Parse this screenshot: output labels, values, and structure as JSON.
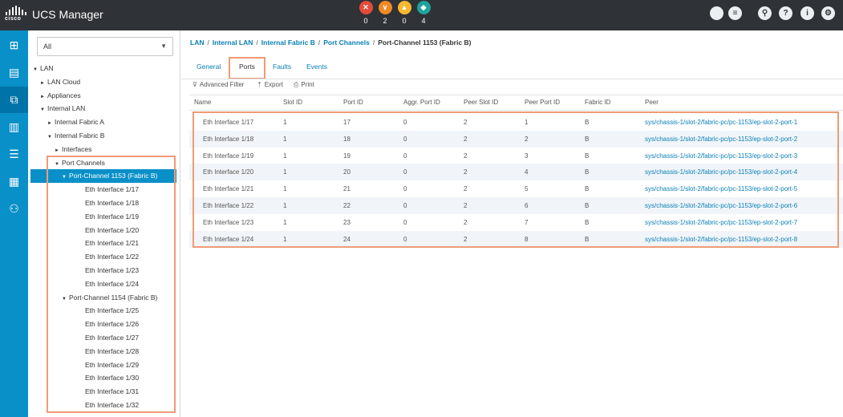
{
  "header": {
    "title": "UCS Manager",
    "logo_text": "cisco",
    "faults": [
      {
        "icon": "critical-x-icon",
        "count": "0",
        "color": "#e44c3a",
        "glyph": "✕"
      },
      {
        "icon": "major-chevron-icon",
        "count": "2",
        "color": "#f08a24",
        "glyph": "∨"
      },
      {
        "icon": "minor-triangle-icon",
        "count": "0",
        "color": "#f5b82e",
        "glyph": "▲"
      },
      {
        "icon": "warning-diamond-icon",
        "count": "4",
        "color": "#1fa39b",
        "glyph": "◆"
      }
    ],
    "right_icons": [
      "circle-icon",
      "menu-icon",
      "search-icon",
      "help-icon",
      "info-icon",
      "settings-icon"
    ]
  },
  "rail": {
    "items": [
      "equipment-icon",
      "servers-icon",
      "lan-icon",
      "san-icon",
      "storage-icon",
      "vm-icon",
      "admin-icon"
    ],
    "active_index": 2
  },
  "navigator": {
    "filter_value": "All",
    "tree": [
      {
        "label": "LAN",
        "level": 0,
        "arrow": "▼"
      },
      {
        "label": "LAN Cloud",
        "level": 1,
        "arrow": "►"
      },
      {
        "label": "Appliances",
        "level": 1,
        "arrow": "►"
      },
      {
        "label": "Internal LAN",
        "level": 1,
        "arrow": "▼"
      },
      {
        "label": "Internal Fabric A",
        "level": 2,
        "arrow": "►"
      },
      {
        "label": "Internal Fabric B",
        "level": 2,
        "arrow": "▼"
      },
      {
        "label": "Interfaces",
        "level": 3,
        "arrow": "►"
      },
      {
        "label": "Port Channels",
        "level": 3,
        "arrow": "▼"
      },
      {
        "label": "Port-Channel 1153 (Fabric B)",
        "level": 4,
        "arrow": "▼",
        "selected": true
      },
      {
        "label": "Eth Interface 1/17",
        "level": 5,
        "arrow": ""
      },
      {
        "label": "Eth Interface 1/18",
        "level": 5,
        "arrow": ""
      },
      {
        "label": "Eth Interface 1/19",
        "level": 5,
        "arrow": ""
      },
      {
        "label": "Eth Interface 1/20",
        "level": 5,
        "arrow": ""
      },
      {
        "label": "Eth Interface 1/21",
        "level": 5,
        "arrow": ""
      },
      {
        "label": "Eth Interface 1/22",
        "level": 5,
        "arrow": ""
      },
      {
        "label": "Eth Interface 1/23",
        "level": 5,
        "arrow": ""
      },
      {
        "label": "Eth Interface 1/24",
        "level": 5,
        "arrow": ""
      },
      {
        "label": "Port-Channel 1154 (Fabric B)",
        "level": 4,
        "arrow": "▼"
      },
      {
        "label": "Eth Interface 1/25",
        "level": 5,
        "arrow": ""
      },
      {
        "label": "Eth Interface 1/26",
        "level": 5,
        "arrow": ""
      },
      {
        "label": "Eth Interface 1/27",
        "level": 5,
        "arrow": ""
      },
      {
        "label": "Eth Interface 1/28",
        "level": 5,
        "arrow": ""
      },
      {
        "label": "Eth Interface 1/29",
        "level": 5,
        "arrow": ""
      },
      {
        "label": "Eth Interface 1/30",
        "level": 5,
        "arrow": ""
      },
      {
        "label": "Eth Interface 1/31",
        "level": 5,
        "arrow": ""
      },
      {
        "label": "Eth Interface 1/32",
        "level": 5,
        "arrow": ""
      }
    ]
  },
  "breadcrumb": {
    "links": [
      "LAN",
      "Internal LAN",
      "Internal Fabric B",
      "Port Channels"
    ],
    "current": "Port-Channel 1153 (Fabric B)",
    "separator": "/"
  },
  "tabs": [
    "General",
    "Ports",
    "Faults",
    "Events"
  ],
  "active_tab": "Ports",
  "toolbar": {
    "advanced_filter": "Advanced Filter",
    "export": "Export",
    "print": "Print"
  },
  "table": {
    "columns": [
      "Name",
      "Slot ID",
      "Port ID",
      "Aggr. Port ID",
      "Peer Slot ID",
      "Peer Port ID",
      "Fabric ID",
      "Peer"
    ],
    "rows": [
      [
        "Eth Interface 1/17",
        "1",
        "17",
        "0",
        "2",
        "1",
        "B",
        "sys/chassis-1/slot-2/fabric-pc/pc-1153/ep-slot-2-port-1"
      ],
      [
        "Eth Interface 1/18",
        "1",
        "18",
        "0",
        "2",
        "2",
        "B",
        "sys/chassis-1/slot-2/fabric-pc/pc-1153/ep-slot-2-port-2"
      ],
      [
        "Eth Interface 1/19",
        "1",
        "19",
        "0",
        "2",
        "3",
        "B",
        "sys/chassis-1/slot-2/fabric-pc/pc-1153/ep-slot-2-port-3"
      ],
      [
        "Eth Interface 1/20",
        "1",
        "20",
        "0",
        "2",
        "4",
        "B",
        "sys/chassis-1/slot-2/fabric-pc/pc-1153/ep-slot-2-port-4"
      ],
      [
        "Eth Interface 1/21",
        "1",
        "21",
        "0",
        "2",
        "5",
        "B",
        "sys/chassis-1/slot-2/fabric-pc/pc-1153/ep-slot-2-port-5"
      ],
      [
        "Eth Interface 1/22",
        "1",
        "22",
        "0",
        "2",
        "6",
        "B",
        "sys/chassis-1/slot-2/fabric-pc/pc-1153/ep-slot-2-port-6"
      ],
      [
        "Eth Interface 1/23",
        "1",
        "23",
        "0",
        "2",
        "7",
        "B",
        "sys/chassis-1/slot-2/fabric-pc/pc-1153/ep-slot-2-port-7"
      ],
      [
        "Eth Interface 1/24",
        "1",
        "24",
        "0",
        "2",
        "8",
        "B",
        "sys/chassis-1/slot-2/fabric-pc/pc-1153/ep-slot-2-port-8"
      ]
    ]
  },
  "colors": {
    "topbar": "#2f3237",
    "rail": "#0a90c8",
    "link": "#0a7fb5",
    "highlight_box": "#ef9b76",
    "selected_row": "#0a90c8"
  }
}
